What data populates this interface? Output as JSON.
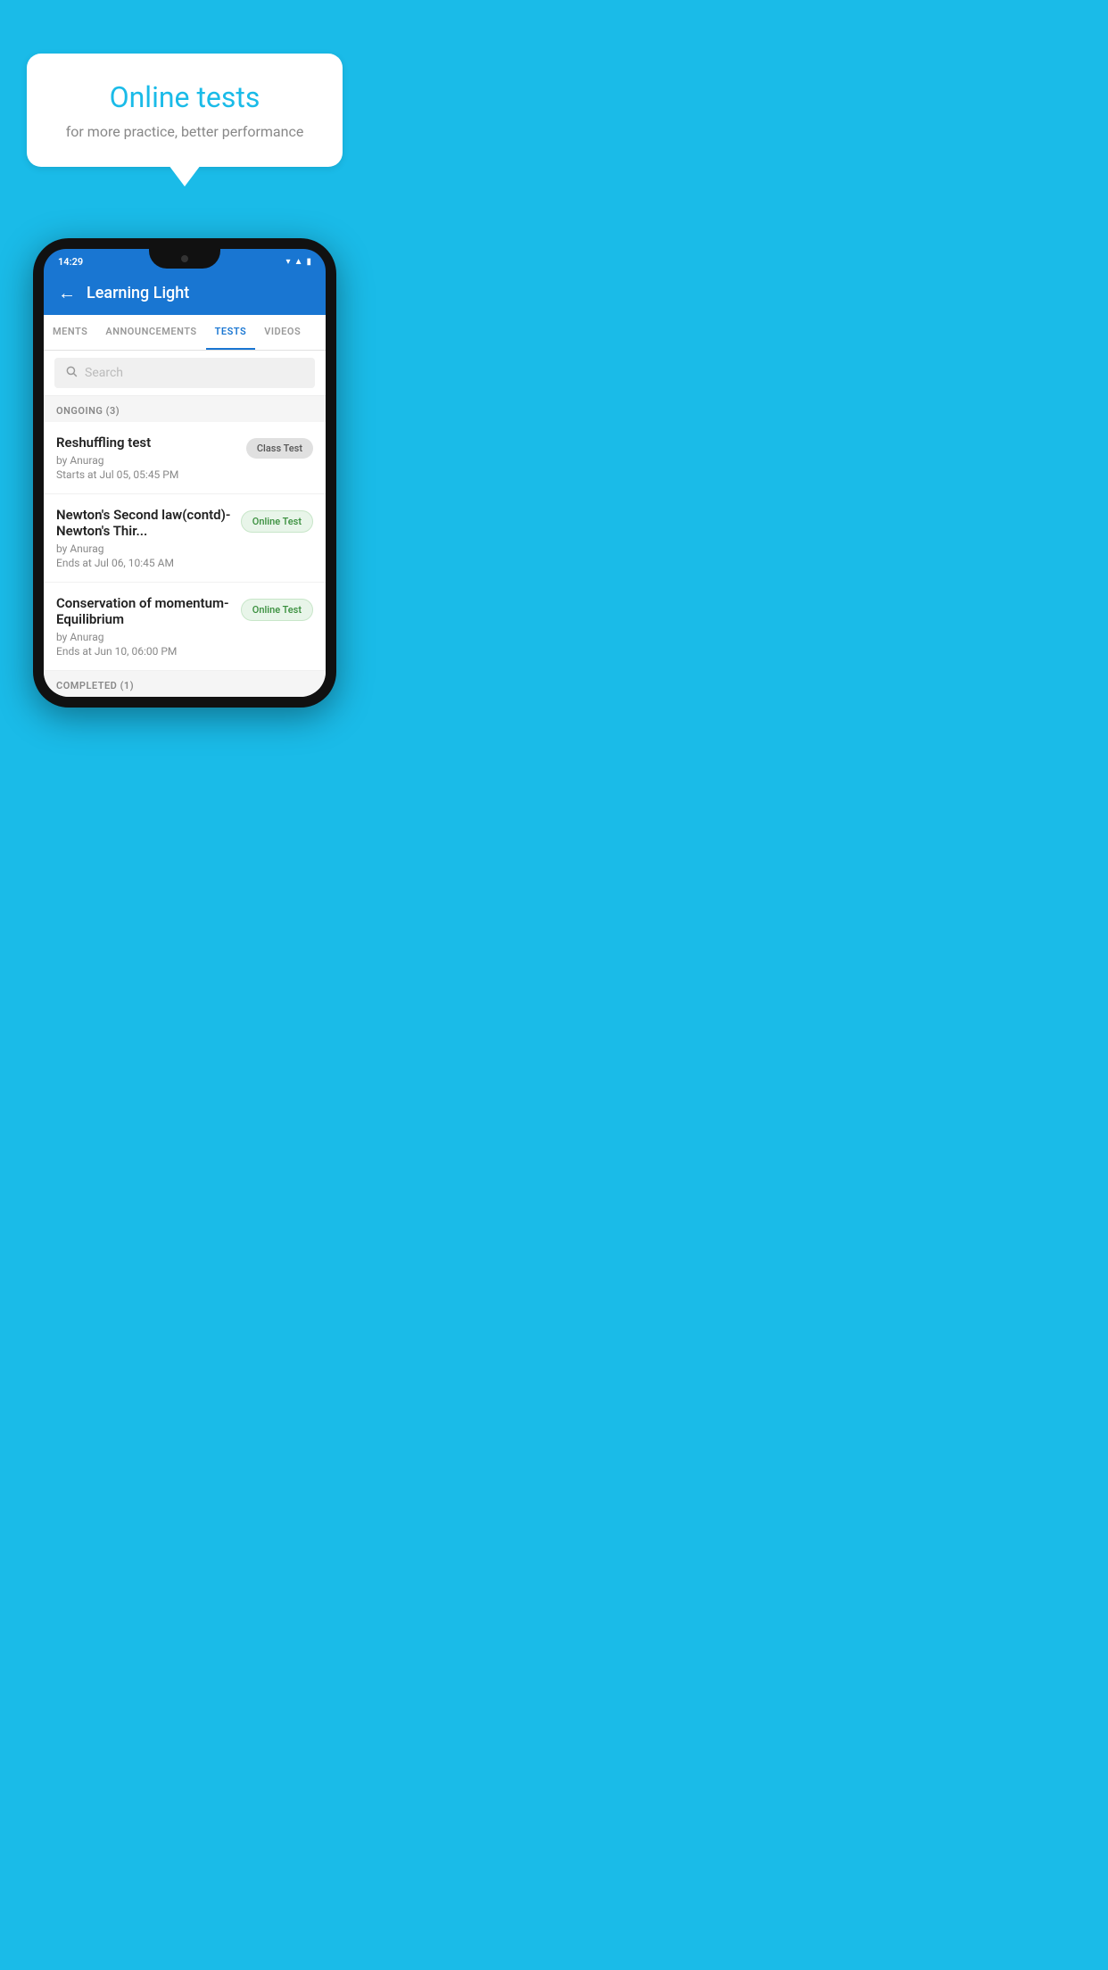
{
  "background_color": "#1ABBE8",
  "hero": {
    "title": "Online tests",
    "subtitle": "for more practice, better performance"
  },
  "phone": {
    "status_time": "14:29",
    "app": {
      "title": "Learning Light",
      "back_label": "←",
      "tabs": [
        {
          "label": "MENTS",
          "active": false
        },
        {
          "label": "ANNOUNCEMENTS",
          "active": false
        },
        {
          "label": "TESTS",
          "active": true
        },
        {
          "label": "VIDEOS",
          "active": false
        }
      ],
      "search_placeholder": "Search",
      "sections": [
        {
          "header": "ONGOING (3)",
          "tests": [
            {
              "name": "Reshuffling test",
              "by": "by Anurag",
              "date": "Starts at  Jul 05, 05:45 PM",
              "badge": "Class Test",
              "badge_type": "class"
            },
            {
              "name": "Newton's Second law(contd)-Newton's Thir...",
              "by": "by Anurag",
              "date": "Ends at  Jul 06, 10:45 AM",
              "badge": "Online Test",
              "badge_type": "online"
            },
            {
              "name": "Conservation of momentum-Equilibrium",
              "by": "by Anurag",
              "date": "Ends at  Jun 10, 06:00 PM",
              "badge": "Online Test",
              "badge_type": "online"
            }
          ]
        }
      ],
      "completed_header": "COMPLETED (1)"
    }
  }
}
